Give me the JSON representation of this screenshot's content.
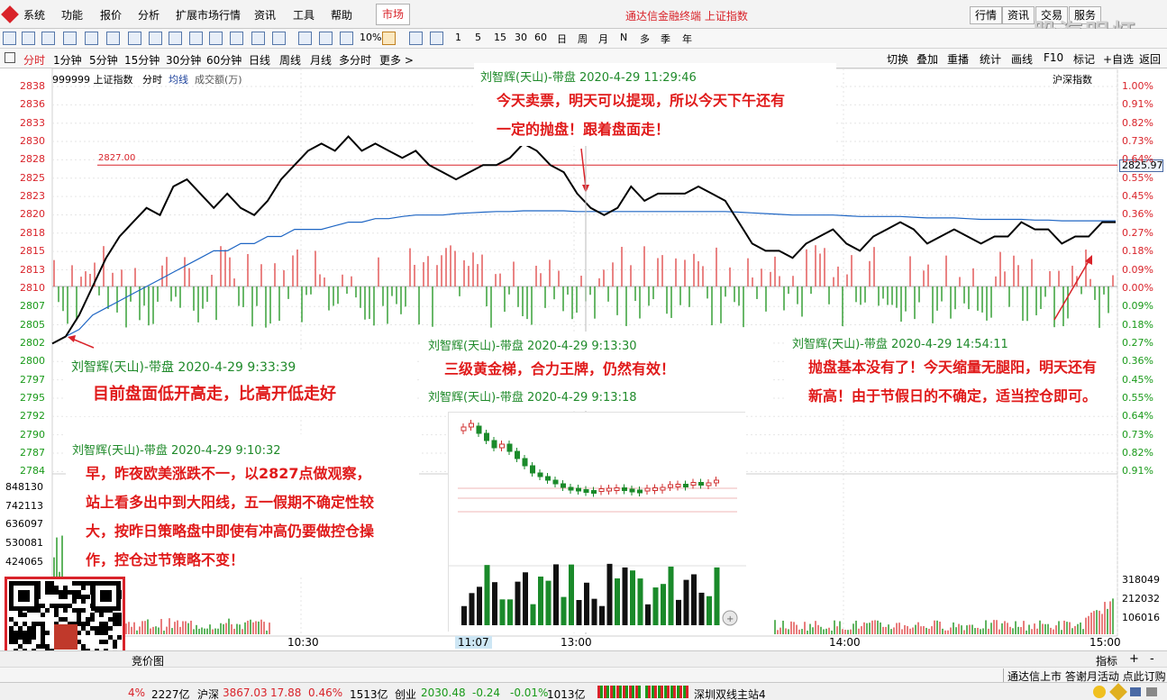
{
  "menubar": {
    "items": [
      "系统",
      "功能",
      "报价",
      "分析",
      "扩展市场行情",
      "资讯",
      "工具",
      "帮助"
    ],
    "market_tab": "市场",
    "app_title": "通达信金融终端 上证指数",
    "right_buttons": [
      "行情",
      "资讯",
      "交易",
      "服务"
    ],
    "brand_watermark": "股海明灯"
  },
  "toolbar": {
    "texts": [
      "10%",
      "1",
      "5",
      "15",
      "30",
      "60",
      "日",
      "周",
      "月",
      "N",
      "多",
      "季",
      "年"
    ]
  },
  "periodbar": {
    "periods": [
      "分时",
      "1分钟",
      "5分钟",
      "15分钟",
      "30分钟",
      "60分钟",
      "日线",
      "周线",
      "月线",
      "多分时",
      "更多 >"
    ],
    "active": "分时",
    "right_buttons": [
      "切换",
      "叠加",
      "重播",
      "统计",
      "画线",
      "F10",
      "标记",
      "+自选",
      "返回"
    ]
  },
  "chart_header": {
    "code": "999999 上证指数",
    "mode": "分时",
    "avg_line": "均线",
    "volume": "成交额(万)",
    "market": "沪深指数",
    "ref_price_label": "2827.00",
    "current_price_tag": "2825.97"
  },
  "price_axis": {
    "left_prices": [
      "2838",
      "2836",
      "2833",
      "2830",
      "2828",
      "2825",
      "2823",
      "2820",
      "2818",
      "2815",
      "2813",
      "2810",
      "2807",
      "2805",
      "2802",
      "2800",
      "2797",
      "2795",
      "2792",
      "2790",
      "2787",
      "2784"
    ],
    "right_pct": [
      "1.00%",
      "0.91%",
      "0.82%",
      "0.73%",
      "0.64%",
      "0.55%",
      "0.45%",
      "0.36%",
      "0.27%",
      "0.18%",
      "0.09%",
      "0.00%",
      "0.09%",
      "0.18%",
      "0.27%",
      "0.36%",
      "0.45%",
      "0.55%",
      "0.64%",
      "0.73%",
      "0.82%",
      "0.91%"
    ],
    "left_volume": [
      "848130",
      "742113",
      "636097",
      "530081",
      "424065"
    ],
    "right_volume": [
      "318049",
      "212032",
      "106016"
    ]
  },
  "time_axis": {
    "labels": [
      "10:30",
      "11:07",
      "13:00",
      "14:00",
      "15:00"
    ]
  },
  "chart_data": {
    "type": "line",
    "title": "",
    "xlabel": "",
    "ylabel": "",
    "ylim": [
      2784,
      2838
    ],
    "reference_line": 2827.0,
    "series": [
      {
        "values": [
          2802,
          2803,
          2806,
          2810,
          2814,
          2817,
          2819,
          2821,
          2820,
          2824,
          2825,
          2823,
          2821,
          2823,
          2821,
          2820,
          2822,
          2825,
          2827,
          2829,
          2830,
          2829,
          2831,
          2829,
          2830,
          2829,
          2828,
          2829,
          2827,
          2826,
          2825,
          2826,
          2827,
          2827,
          2828,
          2830,
          2829,
          2827,
          2826,
          2823,
          2821,
          2820,
          2821,
          2824,
          2822,
          2823,
          2823,
          2823,
          2824,
          2823,
          2822,
          2819,
          2816,
          2815,
          2815,
          2814,
          2816,
          2817,
          2818,
          2816,
          2815,
          2817,
          2818,
          2819,
          2818,
          2816,
          2817,
          2818,
          2817,
          2816,
          2817,
          2817,
          2819,
          2818,
          2818,
          2816,
          2817,
          2817,
          2819,
          2819
        ]
      },
      {
        "values": [
          2802,
          2803,
          2804,
          2806,
          2807,
          2808,
          2809,
          2810,
          2811,
          2812,
          2813,
          2814,
          2815,
          2815,
          2816,
          2816,
          2817,
          2817,
          2818,
          2818,
          2818,
          2818.5,
          2819,
          2819,
          2819.5,
          2819.5,
          2819.8,
          2820,
          2820,
          2820,
          2820.2,
          2820.3,
          2820.4,
          2820.5,
          2820.5,
          2820.6,
          2820.6,
          2820.6,
          2820.6,
          2820.5,
          2820.5,
          2820.5,
          2820.5,
          2820.5,
          2820.5,
          2820.5,
          2820.5,
          2820.5,
          2820.5,
          2820.5,
          2820.5,
          2820.4,
          2820.3,
          2820.2,
          2820.1,
          2820,
          2820,
          2820,
          2820,
          2819.9,
          2819.8,
          2819.8,
          2819.8,
          2819.8,
          2819.7,
          2819.6,
          2819.6,
          2819.6,
          2819.5,
          2819.4,
          2819.4,
          2819.4,
          2819.4,
          2819.3,
          2819.3,
          2819.2,
          2819.2,
          2819.2,
          2819.2,
          2819.2
        ]
      }
    ],
    "colors": {
      "price": "#000000",
      "avg": "#1f66c4",
      "ref": "#d9232a",
      "up": "#e05050",
      "down": "#2a9a2a"
    }
  },
  "notes": [
    {
      "head": "刘智辉(天山)-带盘 2020-4-29 11:29:46",
      "lines": [
        "今天卖票，明天可以提现，所以今天下午还有",
        "一定的抛盘！跟着盘面走！"
      ]
    },
    {
      "head": "刘智辉(天山)-带盘 2020-4-29 9:33:39",
      "lines": [
        "目前盘面低开高走，比高开低走好"
      ]
    },
    {
      "head": "刘智辉(天山)-带盘 2020-4-29 9:13:30",
      "lines": [
        "三级黄金梯，合力王牌，仍然有效！"
      ]
    },
    {
      "head": "刘智辉(天山)-带盘 2020-4-29 9:13:18",
      "lines": []
    },
    {
      "head": "刘智辉(天山)-带盘 2020-4-29 14:54:11",
      "lines": [
        "抛盘基本没有了！今天缩量无腿阳，明天还有",
        "新高！由于节假日的不确定，适当控仓即可。"
      ]
    },
    {
      "head": "刘智辉(天山)-带盘 2020-4-29 9:10:32",
      "lines": [
        "早，昨夜欧美涨跌不一，以2827点做观察，",
        "站上看多出中到大阳线，五一假期不确定性较",
        "大，按昨日策略盘中即使有冲高仍要做控仓操",
        "作，控仓过节策略不变！"
      ]
    }
  ],
  "bottom": {
    "tab": "竞价图",
    "right_tab": "指标",
    "plus": "+",
    "minus": "-",
    "scroll_text": "通达信上市 答谢月活动 点此订购"
  },
  "statusbar": {
    "seg1_pct": "4%",
    "seg1_amount": "2227亿",
    "hs_name": "沪深",
    "hs_price": "3867.03",
    "hs_change": "17.88",
    "hs_pct": "0.46%",
    "hs_amount": "1513亿",
    "cy_name": "创业",
    "cy_price": "2030.48",
    "cy_change": "-0.24",
    "cy_pct": "-0.01%",
    "cy_amount": "1013亿",
    "server": "深圳双线主站4"
  }
}
